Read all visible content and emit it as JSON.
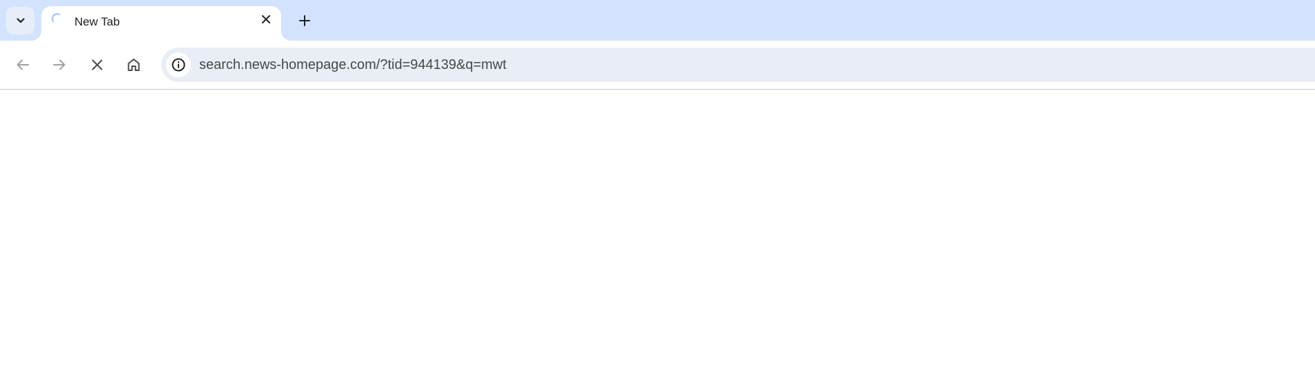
{
  "browser": {
    "tab_strip": {
      "tab_search_icon": "chevron-down-icon",
      "tabs": [
        {
          "title": "New Tab",
          "favicon": "loading-spinner-icon",
          "close_icon": "close-icon"
        }
      ],
      "new_tab_icon": "plus-icon"
    },
    "toolbar": {
      "back_icon": "arrow-left-icon",
      "forward_icon": "arrow-right-icon",
      "stop_icon": "close-icon",
      "home_icon": "home-icon",
      "site_info_icon": "info-icon",
      "url": "search.news-homepage.com/?tid=944139&q=mwt"
    }
  },
  "colors": {
    "tab_strip_bg": "#d3e3fd",
    "omnibox_bg": "#e9eef6",
    "tab_bg": "#ffffff",
    "spinner": "#a8c7fa"
  }
}
